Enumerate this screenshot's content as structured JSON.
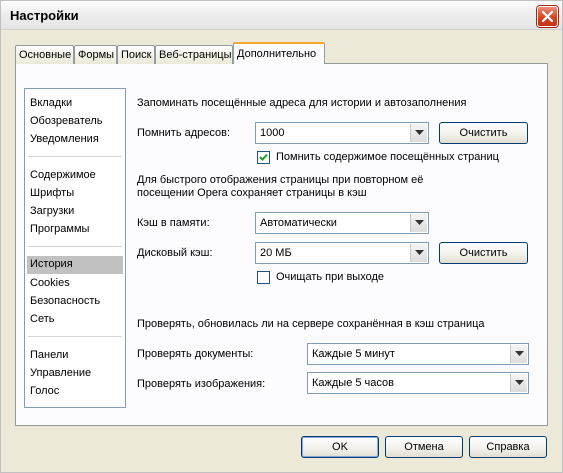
{
  "window": {
    "title": "Настройки"
  },
  "tabs": [
    {
      "label": "Основные"
    },
    {
      "label": "Формы"
    },
    {
      "label": "Поиск"
    },
    {
      "label": "Веб-страницы"
    },
    {
      "label": "Дополнительно"
    }
  ],
  "sidebar": {
    "items": [
      {
        "label": "Вкладки"
      },
      {
        "label": "Обозреватель"
      },
      {
        "label": "Уведомления"
      },
      {
        "label": "Содержимое"
      },
      {
        "label": "Шрифты"
      },
      {
        "label": "Загрузки"
      },
      {
        "label": "Программы"
      },
      {
        "label": "История"
      },
      {
        "label": "Cookies"
      },
      {
        "label": "Безопасность"
      },
      {
        "label": "Сеть"
      },
      {
        "label": "Панели"
      },
      {
        "label": "Управление"
      },
      {
        "label": "Голос"
      }
    ]
  },
  "history": {
    "heading": "Запоминать посещённые адреса для истории и автозаполнения",
    "remember_label": "Помнить адресов:",
    "remember_value": "1000",
    "clear1": "Очистить",
    "remember_content_label": "Помнить содержимое посещённых страниц",
    "remember_content_checked": true
  },
  "cache": {
    "info_line1": "Для быстрого отображения страницы при повторном её",
    "info_line2": "посещении Opera сохраняет страницы в кэш",
    "memory_label": "Кэш в памяти:",
    "memory_value": "Автоматически",
    "disk_label": "Дисковый кэш:",
    "disk_value": "20 МБ",
    "clear2": "Очистить",
    "clear_on_exit_label": "Очищать при выходе",
    "clear_on_exit_checked": false
  },
  "check": {
    "heading": "Проверять, обновилась ли на сервере сохранённая в кэш страница",
    "docs_label": "Проверять документы:",
    "docs_value": "Каждые 5 минут",
    "images_label": "Проверять изображения:",
    "images_value": "Каждые 5 часов"
  },
  "footer": {
    "ok": "OK",
    "cancel": "Отмена",
    "help": "Справка"
  }
}
